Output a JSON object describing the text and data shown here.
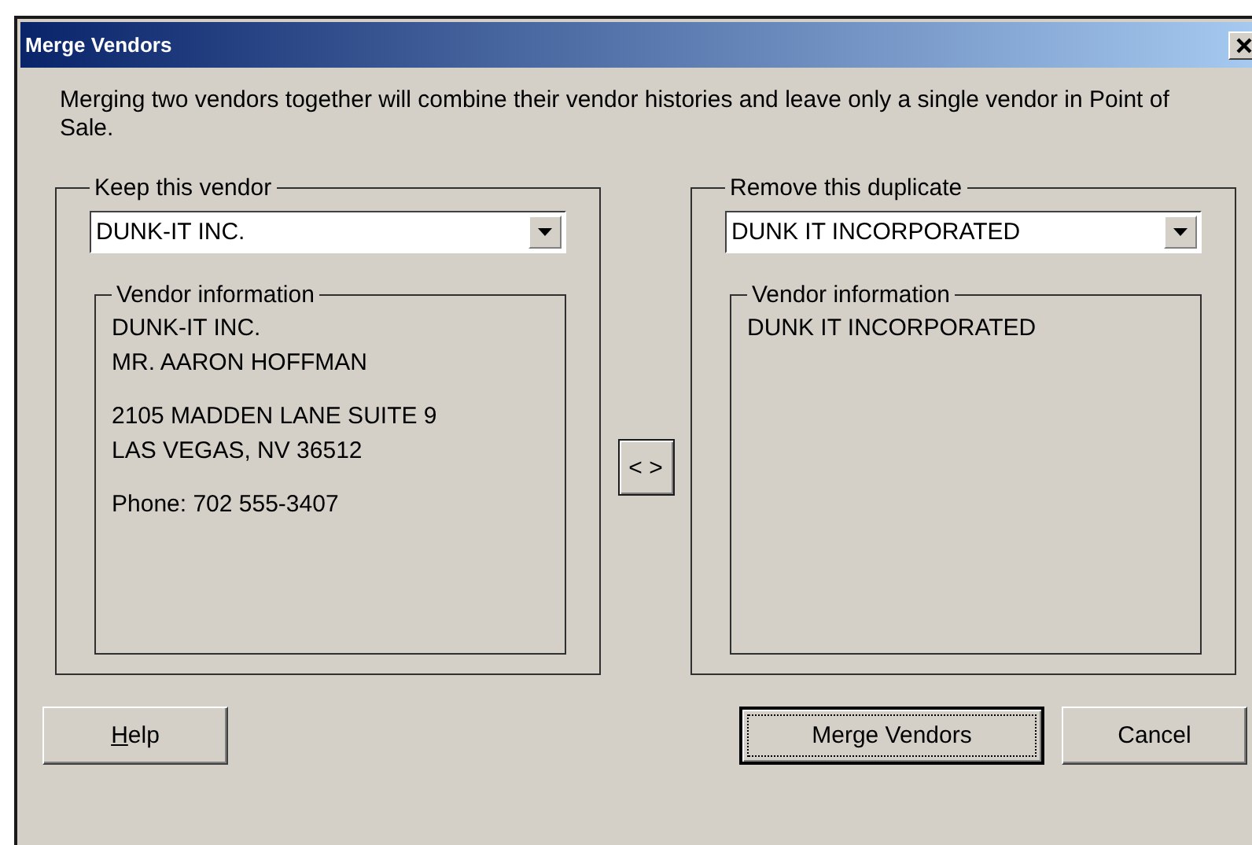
{
  "window": {
    "title": "Merge Vendors"
  },
  "description": "Merging two vendors together will combine their vendor histories and leave only a single vendor in Point of Sale.",
  "panels": [
    {
      "legend": "Keep this vendor",
      "vendor": "DUNK-IT INC.",
      "info_legend": "Vendor information",
      "info_blocks": [
        [
          "DUNK-IT INC.",
          "MR. AARON HOFFMAN"
        ],
        [
          "2105 MADDEN LANE SUITE 9",
          "LAS VEGAS, NV 36512"
        ],
        [
          "Phone: 702 555-3407"
        ]
      ]
    },
    {
      "legend": "Remove this duplicate",
      "vendor": "DUNK IT INCORPORATED",
      "info_legend": "Vendor information",
      "info_blocks": [
        [
          "DUNK IT INCORPORATED"
        ]
      ]
    }
  ],
  "swap_button": "< >",
  "help_button": {
    "label": "Help",
    "access_key": true,
    "default": false
  },
  "buttons": [
    {
      "label": "Merge Vendors",
      "access_key": false,
      "default": true
    },
    {
      "label": "Cancel",
      "access_key": false,
      "default": false
    }
  ]
}
